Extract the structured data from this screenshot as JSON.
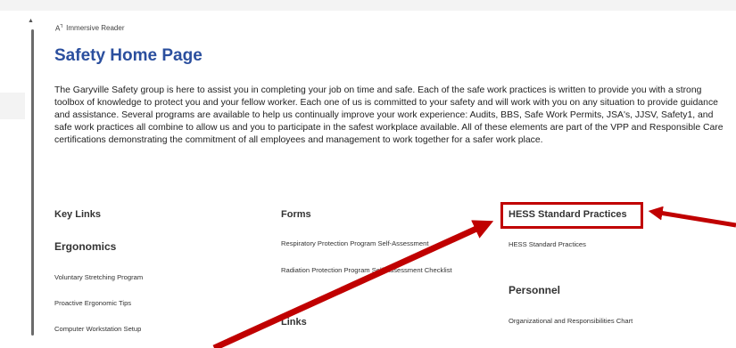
{
  "reader": {
    "label": "Immersive Reader"
  },
  "page": {
    "title": "Safety Home Page",
    "intro": "The Garyville Safety group is here to assist you in completing your job on time and safe. Each of the safe work practices is written to provide you with a strong toolbox of knowledge to protect you and your fellow worker. Each one of us is committed to your safety and will work with you on any situation to provide guidance and assistance. Several programs are available to help us continually improve your work experience: Audits, BBS, Safe Work Permits, JSA's, JJSV, Safety1, and safe work practices all combine to allow us and you to participate in the safest workplace available. All of these elements are part of the VPP and Responsible Care certifications demonstrating the commitment of all employees and management to work together for a safer work place."
  },
  "columns": {
    "key_links": {
      "heading": "Key Links",
      "ergonomics_heading": "Ergonomics",
      "items": [
        "Voluntary Stretching Program",
        "Proactive Ergonomic Tips",
        "Computer Workstation Setup"
      ]
    },
    "forms": {
      "heading": "Forms",
      "items": [
        "Respiratory Protection Program Self-Assessment",
        "Radiation Protection Program Self-Assessment Checklist"
      ],
      "links_heading": "Links"
    },
    "hess": {
      "heading": "HESS Standard Practices",
      "items": [
        "HESS Standard Practices"
      ],
      "personnel_heading": "Personnel",
      "personnel_items": [
        "Organizational and Responsibilities Chart"
      ]
    }
  },
  "annotation": {
    "color": "#c00000"
  }
}
